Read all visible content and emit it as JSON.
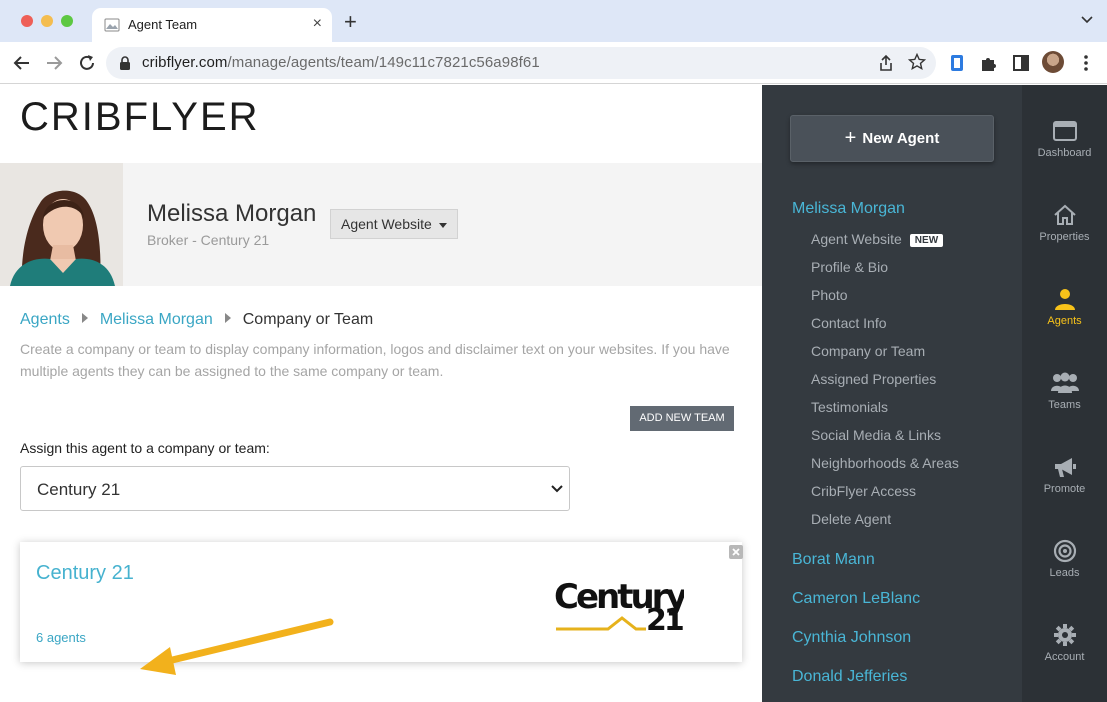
{
  "browser": {
    "tab_title": "Agent Team",
    "url_host": "cribflyer.com",
    "url_path": "/manage/agents/team/149c11c7821c56a98f61"
  },
  "brand": {
    "logo_text": "CRIBFLYER",
    "accent_color": "#49b6d6",
    "active_color": "#f7c21a"
  },
  "profile": {
    "name": "Melissa Morgan",
    "subtitle": "Broker - Century 21",
    "website_button": "Agent Website"
  },
  "breadcrumb": {
    "agents": "Agents",
    "agent": "Melissa Morgan",
    "current": "Company or Team"
  },
  "content": {
    "description": "Create a company or team to display company information, logos and disclaimer text on your websites. If you have multiple agents they can be assigned to the same company or team.",
    "add_team_button": "ADD NEW TEAM",
    "assign_label": "Assign this agent to a company or team:",
    "selected_team": "Century 21"
  },
  "team_card": {
    "title": "Century 21",
    "agents_count": "6 agents"
  },
  "side_menu": {
    "new_agent_button": "New Agent",
    "current_agent": "Melissa Morgan",
    "sub_items": [
      "Agent Website",
      "Profile & Bio",
      "Photo",
      "Contact Info",
      "Company or Team",
      "Assigned Properties",
      "Testimonials",
      "Social Media & Links",
      "Neighborhoods & Areas",
      "CribFlyer Access",
      "Delete Agent"
    ],
    "new_badge": "NEW",
    "other_agents": [
      "Borat Mann",
      "Cameron LeBlanc",
      "Cynthia Johnson",
      "Donald Jefferies"
    ]
  },
  "rail": {
    "items": [
      "Dashboard",
      "Properties",
      "Agents",
      "Teams",
      "Promote",
      "Leads",
      "Account"
    ],
    "active": "Agents"
  }
}
